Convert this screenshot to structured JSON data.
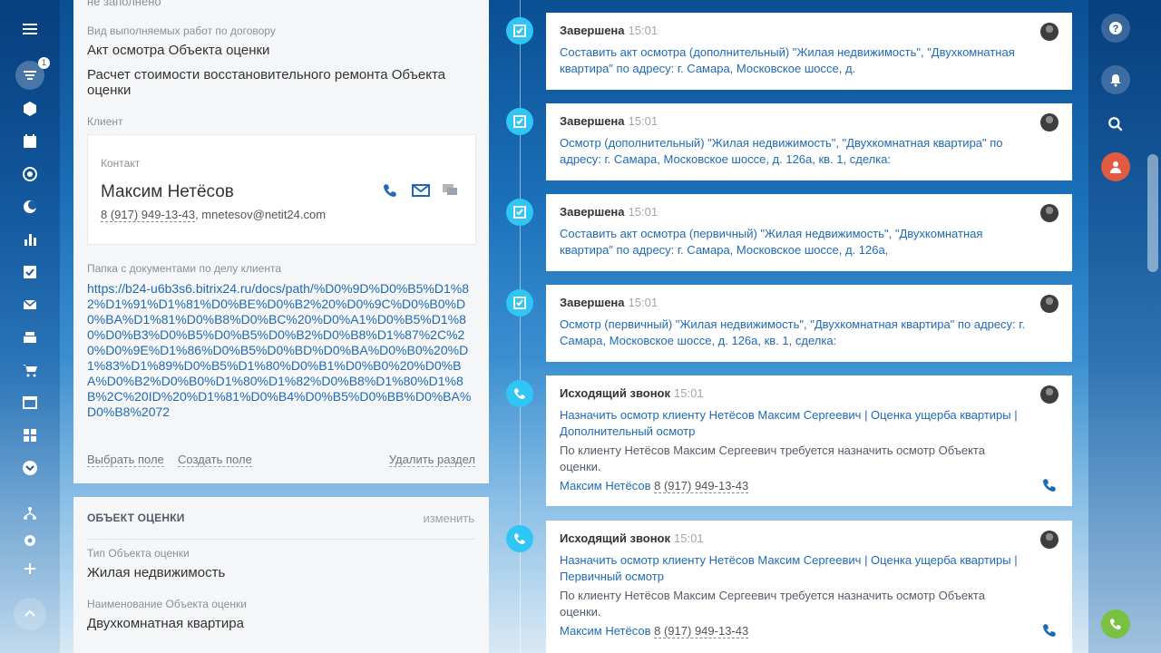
{
  "sidebar": {
    "badge": "1",
    "items": [
      "menu-icon",
      "filter-icon",
      "box-icon",
      "calendar-icon",
      "target-icon",
      "moon-icon",
      "chart-icon",
      "checkbox-icon",
      "mail-icon",
      "inbox-icon",
      "cart-icon",
      "window-icon",
      "grid-icon",
      "chevron-down-icon",
      "sitemap-icon",
      "gear-icon",
      "plus-icon",
      "arrow-up-icon"
    ]
  },
  "left": {
    "top_cut_text": "не заполнено",
    "work_type_label": "Вид выполняемых работ по договору",
    "work_type_1": "Акт осмотра Объекта оценки",
    "work_type_2": "Расчет стоимости восстановительного ремонта Объекта оценки",
    "client_label": "Клиент",
    "contact_label": "Контакт",
    "contact_name": "Максим Нетёсов",
    "contact_phone": "8 (917) 949-13-43",
    "contact_email": ", mnetesov@netit24.com",
    "folder_label": "Папка с документами по делу клиента",
    "folder_url": "https://b24-u6b3s6.bitrix24.ru/docs/path/%D0%9D%D0%B5%D1%82%D1%91%D1%81%D0%BE%D0%B2%20%D0%9C%D0%B0%D0%BA%D1%81%D0%B8%D0%BC%20%D0%A1%D0%B5%D1%80%D0%B3%D0%B5%D0%B5%D0%B2%D0%B8%D1%87%2C%20%D0%9E%D1%86%D0%B5%D0%BD%D0%BA%D0%B0%20%D1%83%D1%89%D0%B5%D1%80%D0%B1%D0%B0%20%D0%BA%D0%B2%D0%B0%D1%80%D1%82%D0%B8%D1%80%D1%8B%2C%20ID%20%D1%81%D0%B4%D0%B5%D0%BB%D0%BA%D0%B8%2072",
    "choose_field": "Выбрать поле",
    "create_field": "Создать поле",
    "delete_section": "Удалить раздел"
  },
  "object": {
    "title": "ОБЪЕКТ ОЦЕНКИ",
    "edit": "изменить",
    "type_label": "Тип Объекта оценки",
    "type_value": "Жилая недвижимость",
    "name_label": "Наименование Объекта оценки",
    "name_value": "Двухкомнатная квартира"
  },
  "timeline": [
    {
      "type": "task",
      "status": "Завершена",
      "time": "15:01",
      "text": "Составить акт осмотра (дополнительный) \"Жилая недвижимость\", \"Двухкомнатная квартира\" по адресу: г. Самара, Московское шоссе, д."
    },
    {
      "type": "task",
      "status": "Завершена",
      "time": "15:01",
      "text": "Осмотр (дополнительный) \"Жилая недвижимость\", \"Двухкомнатная квартира\" по адресу: г. Самара, Московское шоссе, д. 126а, кв. 1, сделка:"
    },
    {
      "type": "task",
      "status": "Завершена",
      "time": "15:01",
      "text": "Составить акт осмотра (первичный) \"Жилая недвижимость\", \"Двухкомнатная квартира\" по адресу: г. Самара, Московское шоссе, д. 126а,"
    },
    {
      "type": "task",
      "status": "Завершена",
      "time": "15:01",
      "text": "Осмотр (первичный) \"Жилая недвижимость\", \"Двухкомнатная квартира\" по адресу: г. Самара, Московское шоссе, д. 126а, кв. 1, сделка:"
    },
    {
      "type": "call",
      "status": "Исходящий звонок",
      "time": "15:01",
      "text": "Назначить осмотр клиенту Нетёсов Максим Сергеевич | Оценка ущерба квартиры | Дополнительный осмотр",
      "desc": "По клиенту Нетёсов Максим Сергеевич требуется назначить осмотр Объекта оценки.",
      "contact": "Максим Нетёсов",
      "phone": "8 (917) 949-13-43"
    },
    {
      "type": "call",
      "status": "Исходящий звонок",
      "time": "15:01",
      "text": "Назначить осмотр клиенту Нетёсов Максим Сергеевич | Оценка ущерба квартиры | Первичный осмотр",
      "desc": "По клиенту Нетёсов Максим Сергеевич требуется назначить осмотр Объекта оценки.",
      "contact": "Максим Нетёсов",
      "phone": "8 (917) 949-13-43"
    }
  ],
  "colors": {
    "accent": "#2fc6f6",
    "link": "#1f6ab5",
    "danger": "#e05b3f",
    "call_green": "#7ac143"
  }
}
